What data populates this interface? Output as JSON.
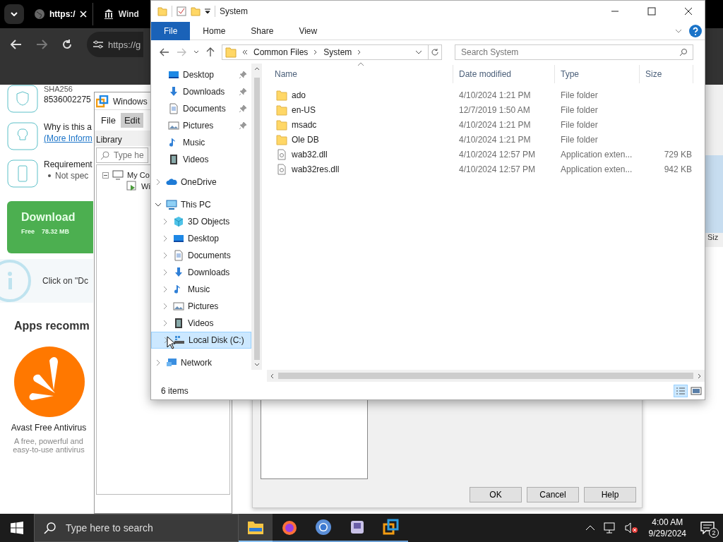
{
  "browser": {
    "tabs": [
      {
        "title": "https:/",
        "selected": true
      },
      {
        "title": "Wind",
        "selected": false
      }
    ],
    "url": "https://g",
    "page": {
      "sha_label": "SHA256",
      "sha_value": "8536002275",
      "why_text": "Why is this a",
      "more_link": "(More Inform",
      "requirements_title": "Requirement",
      "requirements_item": "Not spec",
      "download": {
        "label": "Download",
        "price": "Free",
        "size": "78.32 MB"
      },
      "tip": "Click on \"Dc",
      "apps_heading": "Apps recomm",
      "app": {
        "name": "Avast Free Antivirus",
        "description": "A free, powerful and easy-to-use antivirus"
      }
    }
  },
  "vm_window": {
    "title": "Windows",
    "menu": [
      {
        "label": "File",
        "selected": false
      },
      {
        "label": "Edit",
        "selected": true
      }
    ],
    "library_label": "Library",
    "search_placeholder": "Type he",
    "tree": [
      {
        "label": "My Co",
        "expanded": true,
        "children": [
          {
            "label": "Wi"
          }
        ]
      }
    ]
  },
  "dialog": {
    "buttons": [
      "OK",
      "Cancel",
      "Help"
    ]
  },
  "right_edge": {
    "column": "Siz"
  },
  "explorer": {
    "title": "System",
    "ribbon_tabs": [
      {
        "label": "File",
        "selected": true
      },
      {
        "label": "Home",
        "selected": false
      },
      {
        "label": "Share",
        "selected": false
      },
      {
        "label": "View",
        "selected": false
      }
    ],
    "path": [
      "Common Files",
      "System"
    ],
    "search_placeholder": "Search System",
    "quick_access": [
      {
        "label": "Desktop",
        "kind": "desktop",
        "pinned": true
      },
      {
        "label": "Downloads",
        "kind": "downloads",
        "pinned": true
      },
      {
        "label": "Documents",
        "kind": "documents",
        "pinned": true
      },
      {
        "label": "Pictures",
        "kind": "pictures",
        "pinned": true
      },
      {
        "label": "Music",
        "kind": "music",
        "pinned": false
      },
      {
        "label": "Videos",
        "kind": "videos",
        "pinned": false
      }
    ],
    "tree": [
      {
        "label": "OneDrive",
        "kind": "onedrive",
        "expanded": false,
        "selected": false
      },
      {
        "label": "This PC",
        "kind": "pc",
        "expanded": true,
        "selected": false,
        "children": [
          {
            "label": "3D Objects",
            "kind": "objects3d",
            "expanded": false,
            "selected": false
          },
          {
            "label": "Desktop",
            "kind": "desktop",
            "expanded": false,
            "selected": false
          },
          {
            "label": "Documents",
            "kind": "documents",
            "expanded": false,
            "selected": false
          },
          {
            "label": "Downloads",
            "kind": "downloads",
            "expanded": false,
            "selected": false
          },
          {
            "label": "Music",
            "kind": "music",
            "expanded": false,
            "selected": false
          },
          {
            "label": "Pictures",
            "kind": "pictures",
            "expanded": false,
            "selected": false
          },
          {
            "label": "Videos",
            "kind": "videos",
            "expanded": false,
            "selected": false
          },
          {
            "label": "Local Disk (C:)",
            "kind": "disk",
            "expanded": false,
            "selected": true
          }
        ]
      },
      {
        "label": "Network",
        "kind": "network",
        "expanded": false,
        "selected": false
      }
    ],
    "columns": [
      "Name",
      "Date modified",
      "Type",
      "Size"
    ],
    "files": [
      {
        "kind": "folder",
        "name": "ado",
        "date": "4/10/2024 1:21 PM",
        "type": "File folder"
      },
      {
        "kind": "folder",
        "name": "en-US",
        "date": "12/7/2019 1:50 AM",
        "type": "File folder"
      },
      {
        "kind": "folder",
        "name": "msadc",
        "date": "4/10/2024 1:21 PM",
        "type": "File folder"
      },
      {
        "kind": "folder",
        "name": "Ole DB",
        "date": "4/10/2024 1:21 PM",
        "type": "File folder"
      },
      {
        "kind": "file",
        "name": "wab32.dll",
        "date": "4/10/2024 12:57 PM",
        "type": "Application exten...",
        "size": "729 KB"
      },
      {
        "kind": "file",
        "name": "wab32res.dll",
        "date": "4/10/2024 12:57 PM",
        "type": "Application exten...",
        "size": "942 KB"
      }
    ],
    "status": "6 items"
  },
  "taskbar": {
    "search_placeholder": "Type here to search",
    "apps": [
      {
        "kind": "explorer",
        "active": true
      },
      {
        "kind": "firefox",
        "active": false
      },
      {
        "kind": "chrome",
        "active": false
      },
      {
        "kind": "archive",
        "active": false
      },
      {
        "kind": "vmware",
        "active": false
      }
    ],
    "time": "4:00 AM",
    "date": "9/29/2024",
    "notifications": "2"
  }
}
